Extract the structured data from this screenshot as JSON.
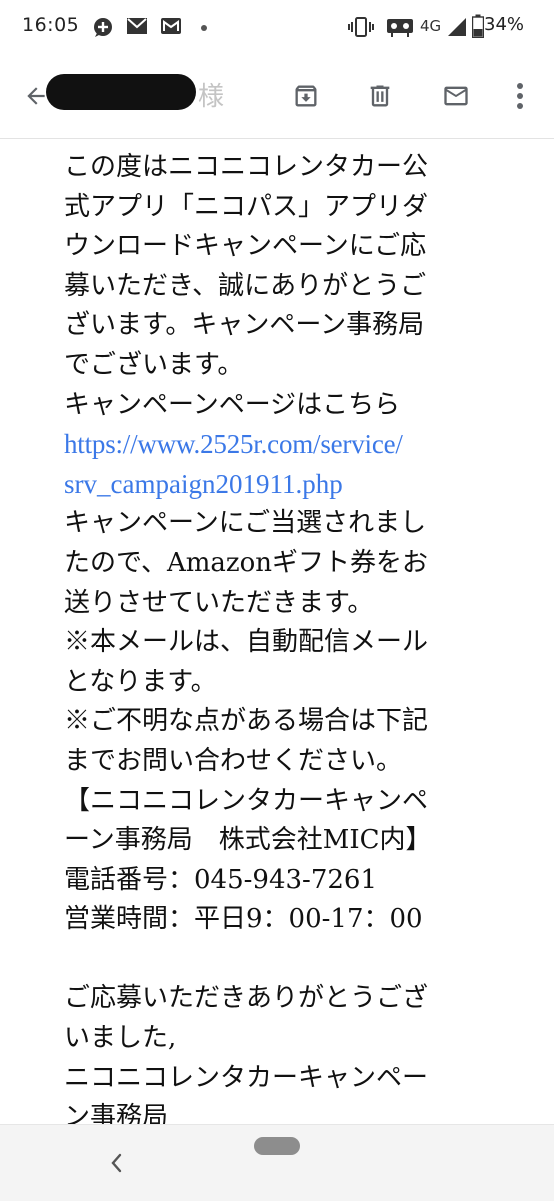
{
  "status_bar": {
    "time": "16:05",
    "network": "4G",
    "battery": "34%"
  },
  "toolbar": {
    "sender_suffix": "様",
    "icons": [
      "back-arrow-icon",
      "archive-icon",
      "delete-icon",
      "mail-unread-icon",
      "more-vert-icon"
    ]
  },
  "mail": {
    "lines": [
      "この度はニコニコレンタカー公",
      "式アプリ「ニコパス」アプリダ",
      "ウンロードキャンペーンにご応",
      "募いただき、誠にありがとうご",
      "ざいます。キャンペーン事務局",
      "でございます。",
      "キャンペーンページはこちら"
    ],
    "link_lines": [
      "https://www.2525r.com/service/",
      "srv_campaign201911.php"
    ],
    "lines_after_link": [
      "キャンペーンにご当選されまし",
      "たので、Amazonギフト券をお",
      "送りさせていただきます。",
      "※本メールは、自動配信メール",
      "となります。",
      "※ご不明な点がある場合は下記",
      "までお問い合わせください。",
      "【ニコニコレンタカーキャンペ",
      "ーン事務局　株式会社MIC内】",
      "電話番号：045-943-7261",
      "営業時間：平日9：00-17：00",
      "",
      "ご応募いただきありがとうござ",
      "いました,",
      "ニコニコレンタカーキャンペー",
      "ン事務局"
    ]
  },
  "colors": {
    "link": "#3b78e7",
    "icon": "#5f6368",
    "text": "#111111"
  }
}
